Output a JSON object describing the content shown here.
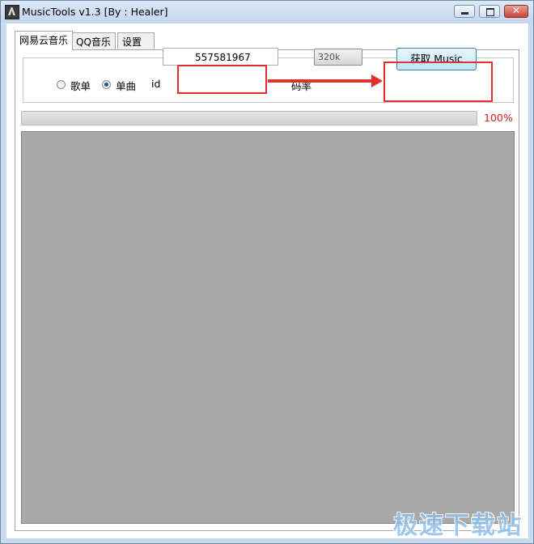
{
  "window": {
    "title": "MusicTools v1.3 [By : Healer]"
  },
  "tabs": [
    {
      "label": "网易云音乐",
      "active": true
    },
    {
      "label": "QQ音乐",
      "active": false
    },
    {
      "label": "设置",
      "active": false
    }
  ],
  "form": {
    "radio_playlist_label": "歌单",
    "radio_single_label": "单曲",
    "selected_mode": "单曲",
    "id_label": "id",
    "id_value": "557581967",
    "bitrate_label": "码率",
    "bitrate_value": "320k",
    "fetch_button_label": "获取 Music"
  },
  "progress": {
    "value": 100,
    "text": "100%"
  },
  "watermark": "极速下载站",
  "colors": {
    "annotation": "#e03030",
    "percent_text": "#d42020",
    "output_background": "#a8a8a8"
  }
}
